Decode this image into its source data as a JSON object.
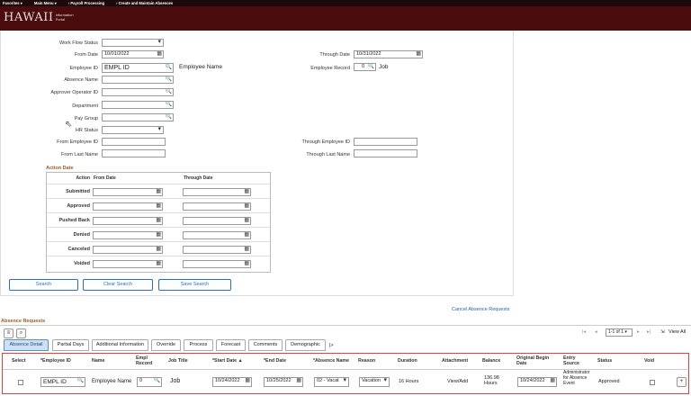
{
  "topnav": {
    "favorites": "Favorites ▾",
    "main_menu": "Main Menu ▾",
    "crumb1": "›  Payroll Processing",
    "crumb2": "›  Create and Maintain Absences"
  },
  "logo": {
    "mark": "HAWAII",
    "sub": "Information Portal"
  },
  "form": {
    "workflow_status_label": "Work Flow Status",
    "from_date_label": "From Date",
    "from_date_value": "10/01/2022",
    "through_date_label": "Through Date",
    "through_date_value": "10/31/2022",
    "employee_id_label": "Employee ID",
    "employee_id_value": "EMPL ID",
    "employee_name": "Employee Name",
    "employee_record_label": "Employee Record",
    "employee_record_value": "0",
    "job_label": "Job",
    "absence_name_label": "Absence Name",
    "approver_label": "Approver Operator ID",
    "department_label": "Department",
    "pay_group_label": "Pay Group",
    "hr_status_label": "HR Status",
    "from_employee_id_label": "From Employee ID",
    "through_employee_id_label": "Through Employee ID",
    "from_last_name_label": "From Last Name",
    "through_last_name_label": "Through Last Name"
  },
  "action_date": {
    "title": "Action Date",
    "col_action": "Action",
    "col_from": "From Date",
    "col_through": "Through Date",
    "rows": [
      "Submitted",
      "Approved",
      "Pushed Back",
      "Denied",
      "Canceled",
      "Voided"
    ]
  },
  "buttons": {
    "search": "Search",
    "clear": "Clear Search",
    "save": "Save Search"
  },
  "cancel_link": "Cancel Absence Requests",
  "requests": {
    "title": "Absence Requests",
    "pagination": "1-1 of 1 ▾",
    "view_all": "View All",
    "tabs": [
      "Absence Detail",
      "Partial Days",
      "Additional Information",
      "Override",
      "Process",
      "Forecast",
      "Comments",
      "Demographic",
      "|>"
    ],
    "headers": {
      "select": "Select",
      "employee_id": "*Employee ID",
      "name": "Name",
      "empl_record": "Empl Record",
      "job_title": "Job Title",
      "start_date": "*Start Date ▲",
      "end_date": "*End Date",
      "absence_name": "*Absence Name",
      "reason": "Reason",
      "duration": "Duration",
      "attachment": "Attachment",
      "balance": "Balance",
      "orig_begin": "Original Begin Date",
      "entry_source": "Entry Source",
      "status": "Status",
      "void": "Void"
    },
    "row": {
      "employee_id": "EMPL ID",
      "name": "Employee Name",
      "empl_record": "0",
      "job_title": "Job",
      "start_date": "10/24/2022",
      "end_date": "10/25/2022",
      "absence_name": "02 - Vacat",
      "reason": "Vacation",
      "duration": "16 Hours",
      "attachment": "View/Add",
      "balance": "136.98 Hours",
      "orig_begin": "10/24/2022",
      "entry_source": "Administrator for Absence Event",
      "status": "Approved"
    }
  }
}
